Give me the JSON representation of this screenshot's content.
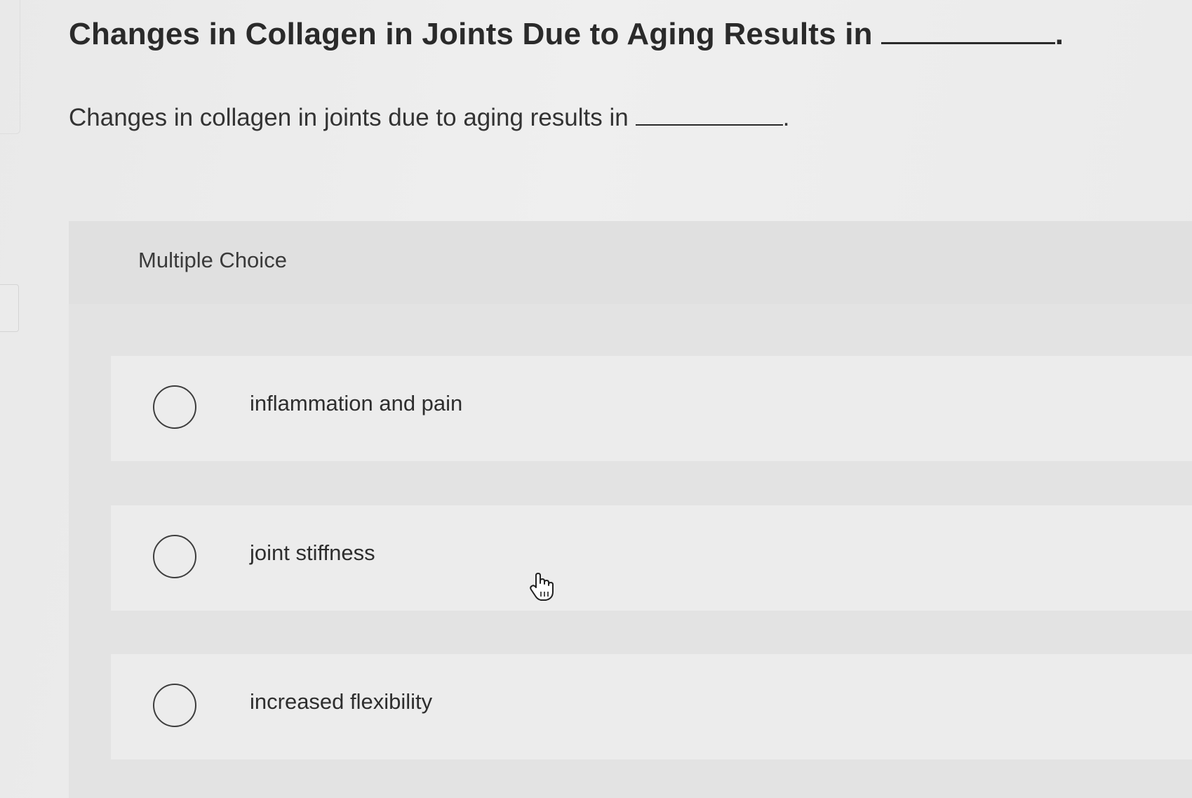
{
  "question": {
    "title": "Changes in Collagen in Joints Due to Aging Results in",
    "title_suffix": ".",
    "text": "Changes in collagen in joints due to aging results in",
    "text_suffix": "."
  },
  "choices": {
    "label": "Multiple Choice",
    "options": [
      {
        "label": "inflammation and pain",
        "selected": false
      },
      {
        "label": "joint stiffness",
        "selected": false
      },
      {
        "label": "increased flexibility",
        "selected": false
      }
    ]
  },
  "cursor": {
    "icon": "hand-pointer-icon"
  }
}
